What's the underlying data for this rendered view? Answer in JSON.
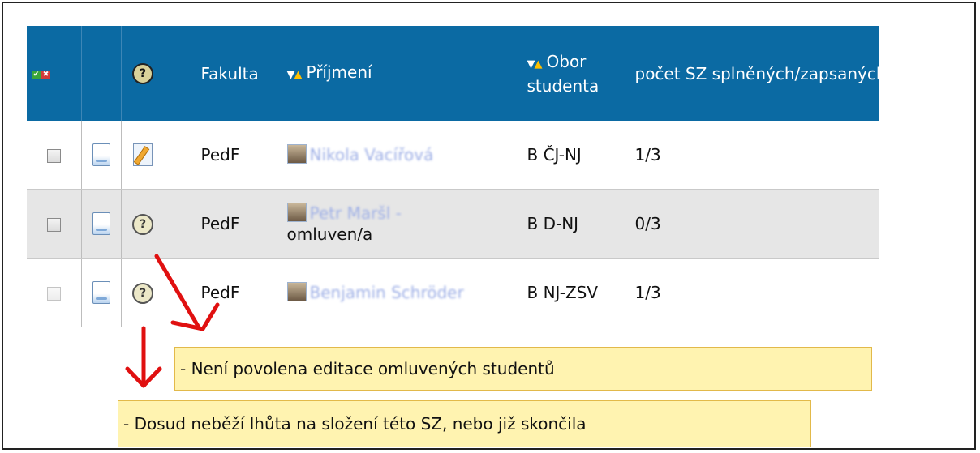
{
  "table": {
    "headers": {
      "select_icons": "check-cross-icon",
      "detail": "",
      "help_icon": "help-icon",
      "blank": "",
      "faculty": "Fakulta",
      "surname": "Příjmení",
      "field": "Obor studenta",
      "count": "počet SZ splněných/zapsaných"
    },
    "rows": [
      {
        "faculty": "PedF",
        "name": "Nikola Vacířová",
        "extra": "",
        "field": "B ČJ-NJ",
        "count": "1/3",
        "action_icon": "edit-icon"
      },
      {
        "faculty": "PedF",
        "name": "Petr Maršl -",
        "extra": "omluven/a",
        "field": "B D-NJ",
        "count": "0/3",
        "action_icon": "help-icon"
      },
      {
        "faculty": "PedF",
        "name": "Benjamin Schröder",
        "extra": "",
        "field": "B NJ-ZSV",
        "count": "1/3",
        "action_icon": "help-icon"
      }
    ]
  },
  "tooltips": {
    "excused": "- Není povolena editace omluvených studentů",
    "deadline": "- Dosud neběží lhůta na složení této SZ, nebo již skončila"
  },
  "colors": {
    "header_bg": "#0b6aa3",
    "tooltip_bg": "#fff3b0",
    "arrow": "#e01010",
    "sort_up": "#ffc000"
  }
}
